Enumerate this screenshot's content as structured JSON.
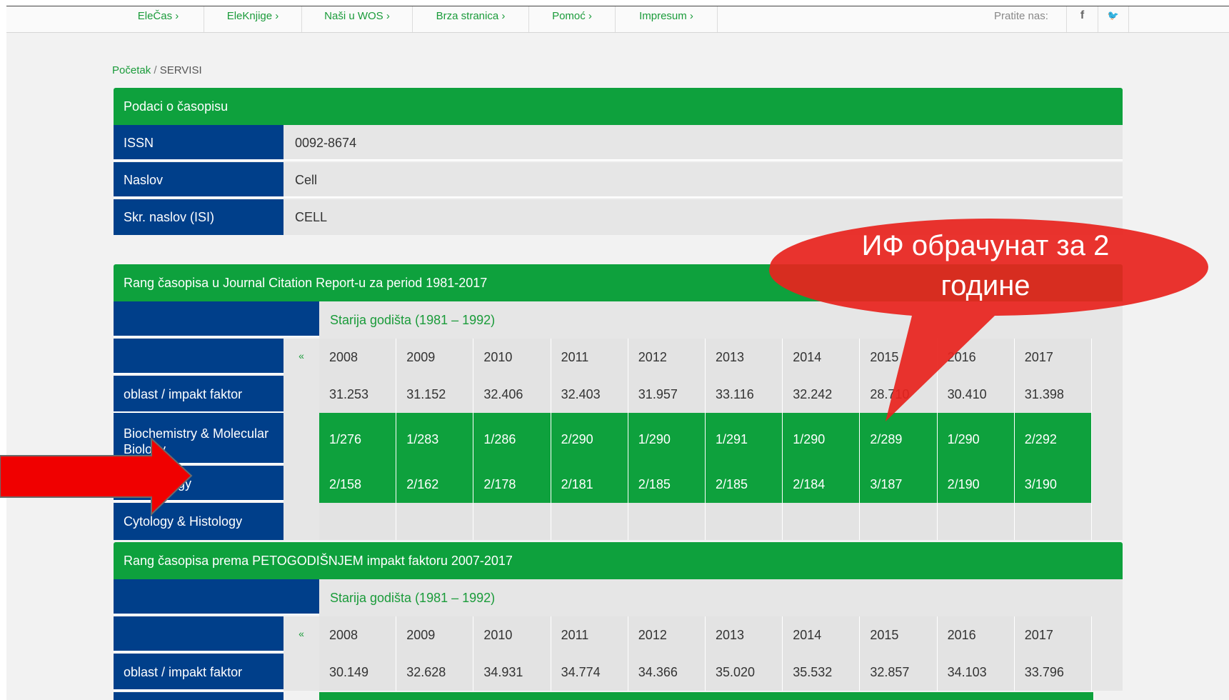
{
  "nav": {
    "items": [
      "EleČas ›",
      "EleKnjige ›",
      "Naši u WOS ›",
      "Brza stranica ›",
      "Pomoć ›",
      "Impresum ›"
    ],
    "follow_label": "Pratite nas:",
    "facebook_glyph": "f",
    "twitter_glyph": "🐦"
  },
  "breadcrumb": {
    "home": "Početak",
    "separator": "/",
    "current": "SERVISI"
  },
  "journal": {
    "title": "Podaci o časopisu",
    "rows": [
      {
        "label": "ISSN",
        "value": "0092-8674"
      },
      {
        "label": "Naslov",
        "value": "Cell"
      },
      {
        "label": "Skr. naslov (ISI)",
        "value": "CELL"
      }
    ]
  },
  "rank_jcr": {
    "title": "Rang časopisa u Journal Citation Report-u za period 1981-2017",
    "older_label": "Starija godišta (1981 – 1992)",
    "prev_glyph": "«",
    "years": [
      "2008",
      "2009",
      "2010",
      "2011",
      "2012",
      "2013",
      "2014",
      "2015",
      "2016",
      "2017"
    ],
    "if_label": "oblast / impakt faktor",
    "if_values": [
      "31.253",
      "31.152",
      "32.406",
      "32.403",
      "31.957",
      "33.116",
      "32.242",
      "28.710",
      "30.410",
      "31.398"
    ],
    "categories": [
      {
        "name": "Biochemistry & Molecular Biology",
        "ranks": [
          "1/276",
          "1/283",
          "1/286",
          "2/290",
          "1/290",
          "1/291",
          "1/290",
          "2/289",
          "1/290",
          "2/292"
        ]
      },
      {
        "name": "Cell Biology",
        "ranks": [
          "2/158",
          "2/162",
          "2/178",
          "2/181",
          "2/185",
          "2/185",
          "2/184",
          "3/187",
          "2/190",
          "3/190"
        ]
      },
      {
        "name": "Cytology & Histology",
        "ranks": [
          "",
          "",
          "",
          "",
          "",
          "",
          "",
          "",
          "",
          ""
        ]
      }
    ]
  },
  "rank_5yr": {
    "title": "Rang časopisa prema PETOGODIŠNJEM impakt faktoru 2007-2017",
    "older_label": "Starija godišta (1981 – 1992)",
    "prev_glyph": "«",
    "years": [
      "2008",
      "2009",
      "2010",
      "2011",
      "2012",
      "2013",
      "2014",
      "2015",
      "2016",
      "2017"
    ],
    "if_label": "oblast / impakt faktor",
    "if_values": [
      "30.149",
      "32.628",
      "34.931",
      "34.774",
      "34.366",
      "35.020",
      "35.532",
      "32.857",
      "34.103",
      "33.796"
    ]
  },
  "callout": {
    "text": "ИФ обрачунат за 2 године",
    "color": "#e8231d"
  },
  "colors": {
    "green": "#0ea13d",
    "blue": "#003f8a",
    "arrow": "#f00000"
  }
}
